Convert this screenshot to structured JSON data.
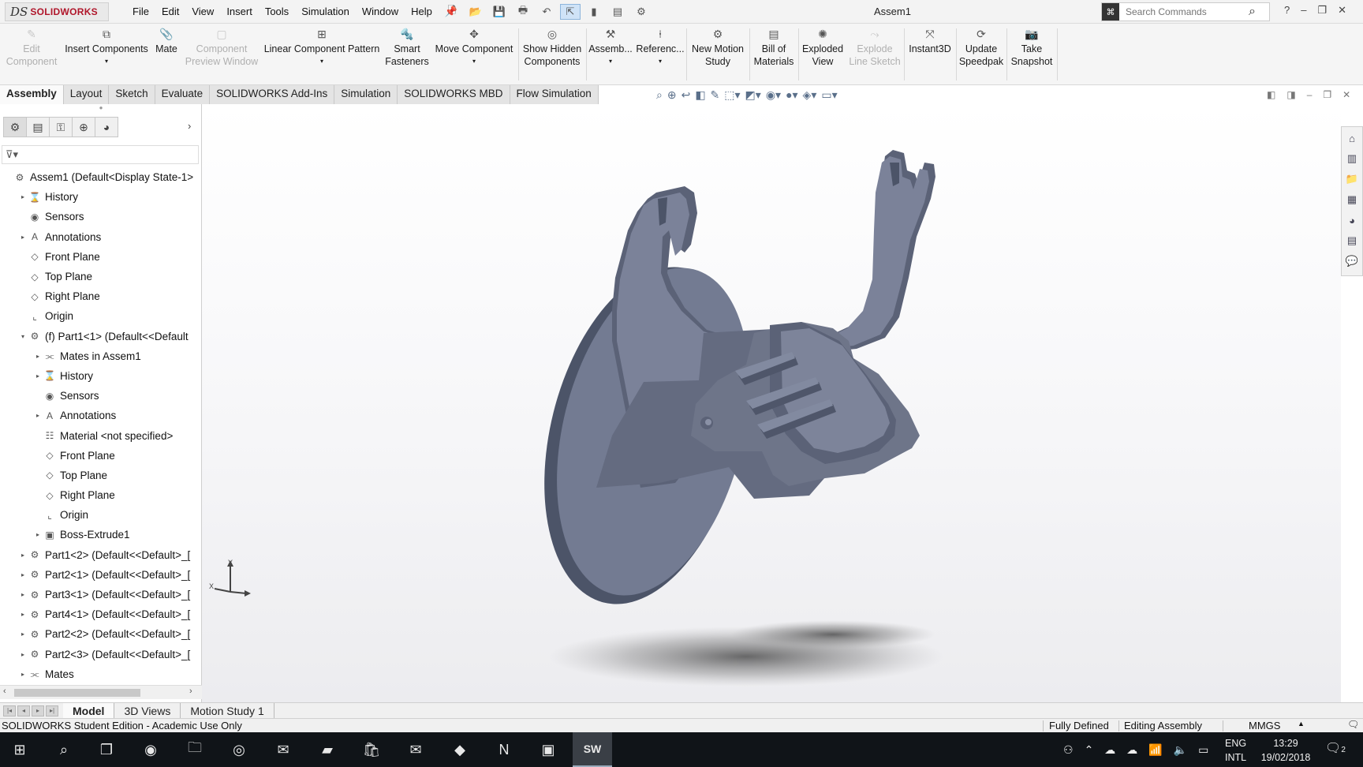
{
  "app": {
    "brand_ds": "DS",
    "brand_name": "SOLIDWORKS",
    "doc_title": "Assem1",
    "search_placeholder": "Search Commands"
  },
  "menu": [
    "File",
    "Edit",
    "View",
    "Insert",
    "Tools",
    "Simulation",
    "Window",
    "Help"
  ],
  "ribbon": {
    "edit_component": "Edit\nComponent",
    "insert_components": "Insert Components",
    "mate": "Mate",
    "component_preview": "Component\nPreview Window",
    "linear_pattern": "Linear Component Pattern",
    "smart_fasteners": "Smart\nFasteners",
    "move_component": "Move Component",
    "show_hidden": "Show Hidden\nComponents",
    "assembly": "Assemb...",
    "reference": "Referenc...",
    "new_motion": "New Motion\nStudy",
    "bom": "Bill of\nMaterials",
    "exploded": "Exploded\nView",
    "explode_line": "Explode\nLine Sketch",
    "instant3d": "Instant3D",
    "speedpak": "Update\nSpeedpak",
    "snapshot": "Take\nSnapshot"
  },
  "tabs": [
    "Assembly",
    "Layout",
    "Sketch",
    "Evaluate",
    "SOLIDWORKS Add-Ins",
    "Simulation",
    "SOLIDWORKS MBD",
    "Flow Simulation"
  ],
  "tree": [
    {
      "label": "Assem1  (Default<Display State-1>",
      "indent": 0,
      "expand": "",
      "icon": "assembly"
    },
    {
      "label": "History",
      "indent": 1,
      "expand": "▸",
      "icon": "history"
    },
    {
      "label": "Sensors",
      "indent": 1,
      "expand": "",
      "icon": "sensor"
    },
    {
      "label": "Annotations",
      "indent": 1,
      "expand": "▸",
      "icon": "annotation"
    },
    {
      "label": "Front Plane",
      "indent": 1,
      "expand": "",
      "icon": "plane"
    },
    {
      "label": "Top Plane",
      "indent": 1,
      "expand": "",
      "icon": "plane"
    },
    {
      "label": "Right Plane",
      "indent": 1,
      "expand": "",
      "icon": "plane"
    },
    {
      "label": "Origin",
      "indent": 1,
      "expand": "",
      "icon": "origin"
    },
    {
      "label": "(f) Part1<1> (Default<<Default",
      "indent": 1,
      "expand": "▾",
      "icon": "part"
    },
    {
      "label": "Mates in Assem1",
      "indent": 2,
      "expand": "▸",
      "icon": "mates"
    },
    {
      "label": "History",
      "indent": 2,
      "expand": "▸",
      "icon": "history"
    },
    {
      "label": "Sensors",
      "indent": 2,
      "expand": "",
      "icon": "sensor"
    },
    {
      "label": "Annotations",
      "indent": 2,
      "expand": "▸",
      "icon": "annotation"
    },
    {
      "label": "Material <not specified>",
      "indent": 2,
      "expand": "",
      "icon": "material"
    },
    {
      "label": "Front Plane",
      "indent": 2,
      "expand": "",
      "icon": "plane"
    },
    {
      "label": "Top Plane",
      "indent": 2,
      "expand": "",
      "icon": "plane"
    },
    {
      "label": "Right Plane",
      "indent": 2,
      "expand": "",
      "icon": "plane"
    },
    {
      "label": "Origin",
      "indent": 2,
      "expand": "",
      "icon": "origin"
    },
    {
      "label": "Boss-Extrude1",
      "indent": 2,
      "expand": "▸",
      "icon": "extrude"
    },
    {
      "label": "Part1<2> (Default<<Default>_[",
      "indent": 1,
      "expand": "▸",
      "icon": "part"
    },
    {
      "label": "Part2<1> (Default<<Default>_[",
      "indent": 1,
      "expand": "▸",
      "icon": "part"
    },
    {
      "label": "Part3<1> (Default<<Default>_[",
      "indent": 1,
      "expand": "▸",
      "icon": "part"
    },
    {
      "label": "Part4<1> (Default<<Default>_[",
      "indent": 1,
      "expand": "▸",
      "icon": "part"
    },
    {
      "label": "Part2<2> (Default<<Default>_[",
      "indent": 1,
      "expand": "▸",
      "icon": "part"
    },
    {
      "label": "Part2<3> (Default<<Default>_[",
      "indent": 1,
      "expand": "▸",
      "icon": "part"
    },
    {
      "label": "Mates",
      "indent": 1,
      "expand": "▸",
      "icon": "mates"
    }
  ],
  "bottom_tabs": [
    "Model",
    "3D Views",
    "Motion Study 1"
  ],
  "status": {
    "edition": "SOLIDWORKS Student Edition - Academic Use Only",
    "defined": "Fully Defined",
    "mode": "Editing Assembly",
    "units": "MMGS",
    "units_arrow": "▲"
  },
  "triad": {
    "x": "X",
    "y": "Y"
  },
  "taskbar": {
    "lang_top": "ENG",
    "lang_bottom": "INTL",
    "time": "13:29",
    "date": "19/02/2018",
    "notifications": "2",
    "sw_app": "SW"
  }
}
